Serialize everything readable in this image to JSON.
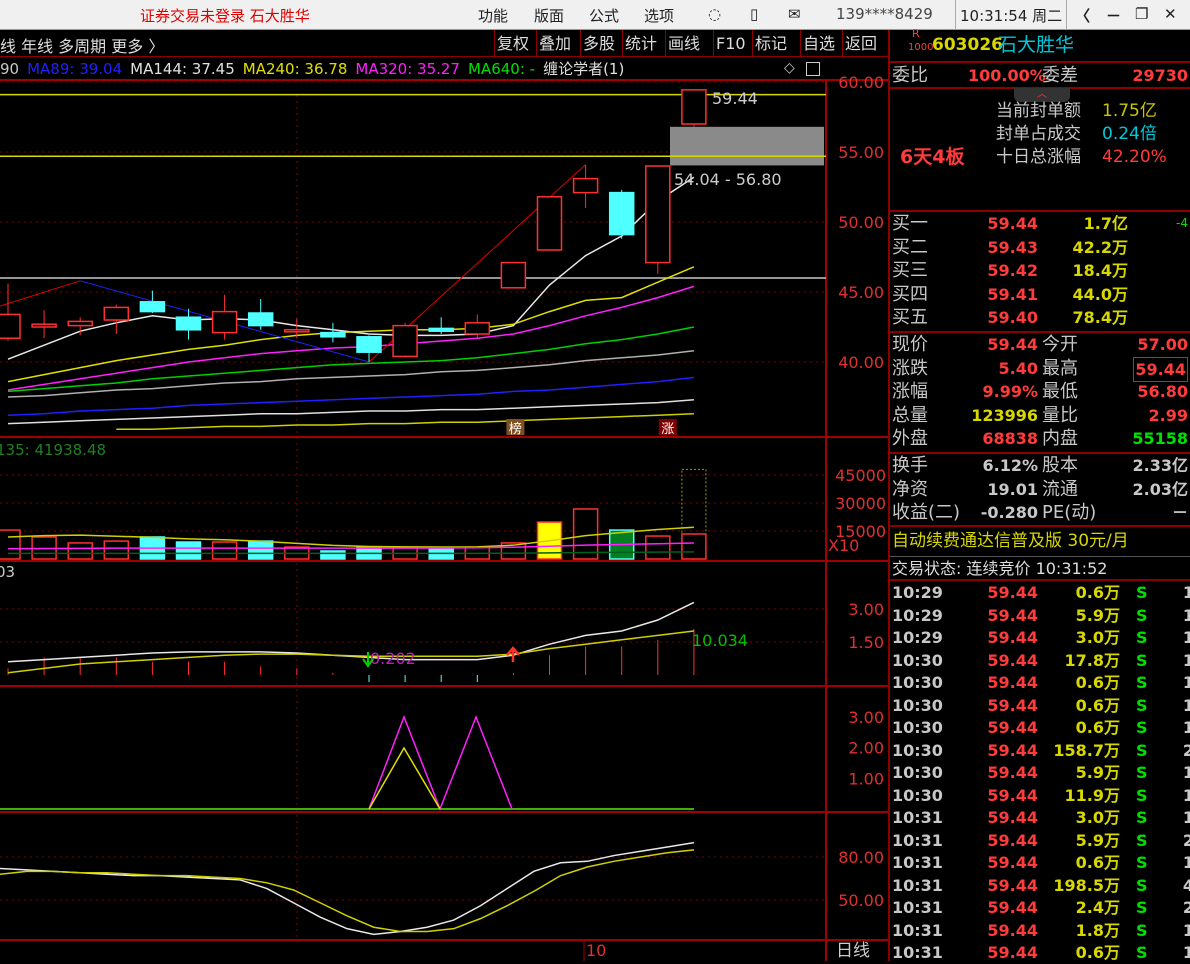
{
  "titlebar": {
    "status": "证券交易未登录  石大胜华",
    "menu": [
      "功能",
      "版面",
      "公式",
      "选项"
    ],
    "phone": "139****8429",
    "clock": "10:31:54 周二",
    "controls": [
      "〈",
      "－",
      "❐",
      "✕"
    ]
  },
  "toolbar": {
    "left": "线 年线 多周期 更多 〉",
    "buttons": [
      "复权",
      "叠加",
      "多股",
      "统计",
      "画线",
      "F10",
      "标记",
      "自选",
      "返回"
    ]
  },
  "ma_legend": [
    {
      "text": "90",
      "color": "#c8c8c8"
    },
    {
      "text": "MA89: 39.04",
      "color": "#2020ff"
    },
    {
      "text": "MA144: 37.45",
      "color": "#e0e0e0"
    },
    {
      "text": "MA240: 36.78",
      "color": "#e0e000"
    },
    {
      "text": "MA320: 35.27",
      "color": "#ff20ff"
    },
    {
      "text": "MA640: -",
      "color": "#00e000"
    },
    {
      "text": "缠论学者(1)",
      "color": "#e0e0e0"
    }
  ],
  "chart_data": {
    "type": "candlestick",
    "price_axis": {
      "ticks": [
        "60.00",
        "55.00",
        "50.00",
        "45.00",
        "40.00"
      ],
      "range": [
        35,
        60
      ]
    },
    "candles": [
      [
        41.7,
        45.6,
        41.5,
        43.4
      ],
      [
        42.5,
        43.7,
        41.7,
        42.7
      ],
      [
        42.6,
        43.2,
        41.9,
        42.9
      ],
      [
        43.0,
        44.1,
        42.0,
        43.9
      ],
      [
        44.3,
        45.1,
        43.5,
        43.6
      ],
      [
        43.2,
        43.8,
        41.6,
        42.3
      ],
      [
        42.1,
        44.8,
        41.6,
        43.6
      ],
      [
        43.5,
        44.5,
        42.3,
        42.6
      ],
      [
        42.3,
        43.1,
        41.7,
        42.3
      ],
      [
        42.1,
        42.8,
        41.4,
        41.8
      ],
      [
        41.8,
        41.9,
        40.0,
        40.7
      ],
      [
        40.4,
        42.8,
        40.3,
        42.6
      ],
      [
        42.4,
        43.2,
        42.0,
        42.2
      ],
      [
        42.0,
        43.4,
        41.7,
        42.8
      ],
      [
        45.3,
        47.1,
        45.3,
        47.1
      ],
      [
        48.0,
        51.8,
        48.0,
        51.8
      ],
      [
        52.1,
        54.1,
        51.0,
        53.1
      ],
      [
        52.1,
        52.3,
        48.8,
        49.1
      ],
      [
        47.1,
        54.0,
        46.3,
        54.0
      ],
      [
        57.0,
        59.44,
        56.8,
        59.44
      ]
    ],
    "ma_lines": [
      {
        "color": "#e8e8e8",
        "values": [
          40.2,
          41.2,
          42.2,
          42.8,
          43.3,
          43.0,
          43.1,
          43.0,
          42.6,
          42.3,
          42.0,
          41.9,
          41.9,
          42.0,
          42.6,
          45.5,
          47.6,
          49.0,
          51.5,
          53.2
        ]
      },
      {
        "color": "#e0e000",
        "values": [
          38.6,
          39.1,
          39.6,
          40.1,
          40.5,
          40.9,
          41.2,
          41.6,
          41.9,
          42.1,
          42.2,
          42.3,
          42.3,
          42.4,
          42.7,
          43.6,
          44.4,
          44.6,
          45.7,
          46.8
        ]
      },
      {
        "color": "#ff20ff",
        "values": [
          38.0,
          38.4,
          38.8,
          39.2,
          39.6,
          40.0,
          40.3,
          40.6,
          40.8,
          41.0,
          41.1,
          41.3,
          41.5,
          41.7,
          42.0,
          42.6,
          43.3,
          43.9,
          44.6,
          45.4
        ]
      },
      {
        "color": "#00d000",
        "values": [
          37.9,
          38.1,
          38.3,
          38.5,
          38.8,
          39.0,
          39.2,
          39.4,
          39.6,
          39.8,
          39.9,
          40.0,
          40.1,
          40.3,
          40.6,
          40.9,
          41.3,
          41.6,
          42.0,
          42.5
        ]
      },
      {
        "color": "#b0b0b0",
        "values": [
          37.5,
          37.6,
          37.8,
          38.0,
          38.1,
          38.3,
          38.5,
          38.6,
          38.8,
          38.9,
          39.0,
          39.1,
          39.3,
          39.4,
          39.6,
          39.8,
          40.1,
          40.3,
          40.5,
          40.8
        ]
      },
      {
        "color": "#2020ff",
        "values": [
          36.2,
          36.3,
          36.5,
          36.6,
          36.7,
          36.9,
          37.0,
          37.1,
          37.2,
          37.3,
          37.4,
          37.5,
          37.6,
          37.7,
          37.9,
          38.0,
          38.2,
          38.4,
          38.6,
          38.9
        ]
      },
      {
        "color": "#e0e0e0",
        "values": [
          35.6,
          35.7,
          35.8,
          35.9,
          36.0,
          36.1,
          36.2,
          36.3,
          36.3,
          36.4,
          36.5,
          36.5,
          36.6,
          36.6,
          36.7,
          36.8,
          36.9,
          37.0,
          37.1,
          37.3
        ]
      },
      {
        "color": "#d0d000",
        "values": [
          null,
          null,
          null,
          35.2,
          35.2,
          35.3,
          35.4,
          35.4,
          35.5,
          35.5,
          35.6,
          35.6,
          35.7,
          35.7,
          35.8,
          35.9,
          36.0,
          36.1,
          36.2,
          36.3
        ]
      }
    ],
    "hlines": [
      {
        "value": 59.1,
        "color": "#d8d800"
      },
      {
        "value": 54.7,
        "color": "#d8d800"
      },
      {
        "value": 46.0,
        "color": "#c8c8c8"
      }
    ],
    "zone": {
      "from": 54.04,
      "to": 56.8,
      "label": "54.04 - 56.80"
    },
    "last_label": "59.44",
    "markers": [
      {
        "index": 14,
        "text": "榜"
      },
      {
        "index": 18,
        "text": "涨"
      }
    ],
    "volume": {
      "label": "135: 41938.48",
      "ticks": [
        "45000",
        "30000",
        "15000"
      ],
      "unit": "X10",
      "values": [
        15500,
        11800,
        8600,
        9600,
        11800,
        9100,
        9100,
        9600,
        6400,
        4300,
        6400,
        6400,
        5900,
        6400,
        8600,
        19800,
        26800,
        15500,
        12300,
        13400
      ],
      "projected": 48000
    },
    "macd": {
      "label": "03",
      "ticks": [
        "3.00",
        "1.50"
      ],
      "value_low": "0.202",
      "value_high": "10.034"
    },
    "indicator2": {
      "ticks": [
        "3.00",
        "2.00",
        "1.00"
      ]
    },
    "kdj": {
      "ticks": [
        "80.00",
        "50.00"
      ],
      "k": [
        72,
        71,
        70,
        69,
        68,
        67,
        67,
        66,
        65,
        64,
        58,
        48,
        38,
        30,
        26,
        28,
        31,
        36,
        46,
        58,
        70,
        76,
        77,
        81,
        84,
        87,
        90
      ],
      "d": [
        68,
        70,
        70,
        69,
        69,
        68,
        67,
        67,
        66,
        65,
        62,
        57,
        48,
        39,
        31,
        28,
        28,
        30,
        37,
        46,
        56,
        67,
        73,
        77,
        80,
        83,
        85
      ]
    },
    "x_label": "10",
    "period": "日线"
  },
  "quote": {
    "badge_top": "R",
    "badge_bottom": "1000",
    "code": "603026",
    "name": "石大胜华",
    "weibi_label": "委比",
    "weibi": "100.00%",
    "weicha_label": "委差",
    "weicha": "29730",
    "boards": "6天4板",
    "info": [
      {
        "label": "当前封单额",
        "value": "1.75亿",
        "color": "#c8c800"
      },
      {
        "label": "封单占成交",
        "value": "0.24倍",
        "color": "#00c8d8"
      },
      {
        "label": "十日总涨幅",
        "value": "42.20%",
        "color": "#ff3b3b"
      }
    ],
    "bids": [
      {
        "label": "买一",
        "price": "59.44",
        "vol": "1.7亿",
        "chg": "-4"
      },
      {
        "label": "买二",
        "price": "59.43",
        "vol": "42.2万",
        "chg": ""
      },
      {
        "label": "买三",
        "price": "59.42",
        "vol": "18.4万",
        "chg": ""
      },
      {
        "label": "买四",
        "price": "59.41",
        "vol": "44.0万",
        "chg": ""
      },
      {
        "label": "买五",
        "price": "59.40",
        "vol": "78.4万",
        "chg": ""
      }
    ],
    "stats": [
      [
        "现价",
        "59.44",
        "r",
        "今开",
        "57.00",
        "r"
      ],
      [
        "涨跌",
        "5.40",
        "r",
        "最高",
        "59.44",
        "r"
      ],
      [
        "涨幅",
        "9.99%",
        "r",
        "最低",
        "56.80",
        "r"
      ],
      [
        "总量",
        "123996",
        "y",
        "量比",
        "2.99",
        "r"
      ],
      [
        "外盘",
        "68838",
        "r",
        "内盘",
        "55158",
        "g"
      ]
    ],
    "fund": [
      [
        "换手",
        "6.12%",
        "股本",
        "2.33亿"
      ],
      [
        "净资",
        "19.01",
        "流通",
        "2.03亿"
      ],
      [
        "收益(二)",
        "-0.280",
        "PE(动)",
        "－"
      ]
    ],
    "ad": "自动续费通达信普及版  30元/月",
    "trade_status": "交易状态: 连续竞价 10:31:52",
    "trades": [
      [
        "10:29",
        "59.44",
        "0.6万",
        "S",
        "1"
      ],
      [
        "10:29",
        "59.44",
        "5.9万",
        "S",
        "1"
      ],
      [
        "10:29",
        "59.44",
        "3.0万",
        "S",
        "1"
      ],
      [
        "10:30",
        "59.44",
        "17.8万",
        "S",
        "1"
      ],
      [
        "10:30",
        "59.44",
        "0.6万",
        "S",
        "1"
      ],
      [
        "10:30",
        "59.44",
        "0.6万",
        "S",
        "1"
      ],
      [
        "10:30",
        "59.44",
        "0.6万",
        "S",
        "1"
      ],
      [
        "10:30",
        "59.44",
        "158.7万",
        "S",
        "2"
      ],
      [
        "10:30",
        "59.44",
        "5.9万",
        "S",
        "1"
      ],
      [
        "10:30",
        "59.44",
        "11.9万",
        "S",
        "1"
      ],
      [
        "10:31",
        "59.44",
        "3.0万",
        "S",
        "1"
      ],
      [
        "10:31",
        "59.44",
        "5.9万",
        "S",
        "2"
      ],
      [
        "10:31",
        "59.44",
        "0.6万",
        "S",
        "1"
      ],
      [
        "10:31",
        "59.44",
        "198.5万",
        "S",
        "4"
      ],
      [
        "10:31",
        "59.44",
        "2.4万",
        "S",
        "2"
      ],
      [
        "10:31",
        "59.44",
        "1.8万",
        "S",
        "1"
      ],
      [
        "10:31",
        "59.44",
        "0.6万",
        "S",
        "1"
      ]
    ]
  }
}
